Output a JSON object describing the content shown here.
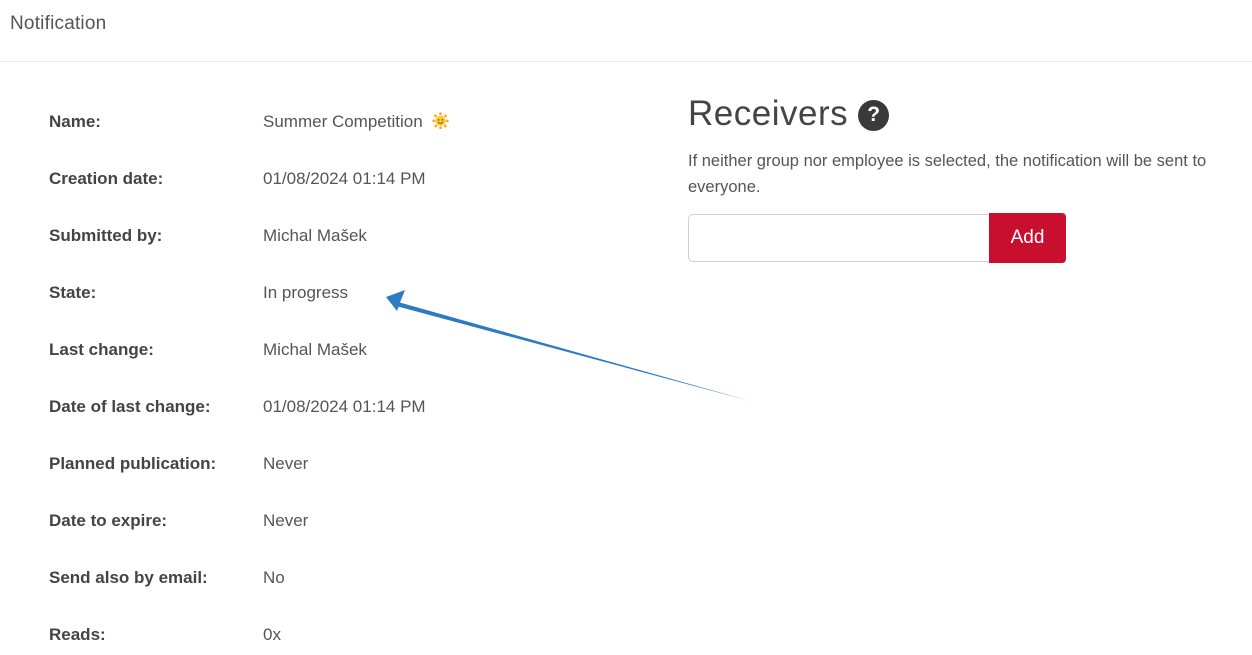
{
  "header": {
    "title": "Notification"
  },
  "details": [
    {
      "label": "Name:",
      "value": "Summer Competition"
    },
    {
      "label": "Creation date:",
      "value": "01/08/2024 01:14 PM"
    },
    {
      "label": "Submitted by:",
      "value": "Michal Mašek"
    },
    {
      "label": "State:",
      "value": "In progress"
    },
    {
      "label": "Last change:",
      "value": "Michal Mašek"
    },
    {
      "label": "Date of last change:",
      "value": "01/08/2024 01:14 PM"
    },
    {
      "label": "Planned publication:",
      "value": "Never"
    },
    {
      "label": "Date to expire:",
      "value": "Never"
    },
    {
      "label": "Send also by email:",
      "value": "No"
    },
    {
      "label": "Reads:",
      "value": "0x"
    }
  ],
  "name_emoji": "sun-face-icon",
  "receivers": {
    "title": "Receivers",
    "help_icon": "question-mark-icon",
    "info": "If neither group nor employee is selected, the notification will be sent to everyone.",
    "input_value": "",
    "add_label": "Add"
  },
  "colors": {
    "accent": "#c8102e",
    "arrow": "#2e7bc4"
  }
}
